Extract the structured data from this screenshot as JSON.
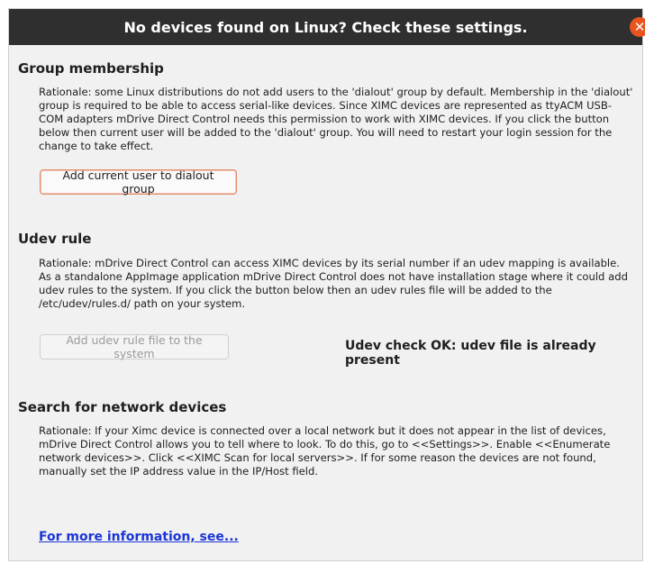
{
  "dialog": {
    "title": "No devices found on Linux? Check these settings.",
    "close_glyph": "✕"
  },
  "group": {
    "title": "Group membership",
    "rationale": "Rationale: some Linux distributions do not add users to the 'dialout' group by default. Membership in the 'dialout' group is required to be able to access serial-like devices. Since XIMC devices are represented as ttyACM USB-COM adapters mDrive Direct Control needs this permission to work with XIMC devices. If you click the button below then current user will be added to the 'dialout' group. You will need to restart your login session for the change to take effect.",
    "button_label": "Add current user to dialout group"
  },
  "udev": {
    "title": "Udev rule",
    "rationale": "Rationale: mDrive Direct Control can access XIMC devices by its serial number if an udev mapping is available. As a standalone AppImage application mDrive Direct Control does not have installation stage where it could add udev rules to the system. If you click the button below then an udev rules file will be added to the /etc/udev/rules.d/ path on your system.",
    "button_label": "Add udev rule file to the system",
    "status": "Udev check OK: udev file is already present"
  },
  "network": {
    "title": "Search for network devices",
    "rationale": "Rationale: If your Ximc device is connected over a local network but it does not appear in the list of devices, mDrive Direct Control allows you to tell where to look. To do this, go to <<Settings>>. Enable <<Enumerate network devices>>. Click <<XIMC Scan for local servers>>. If for some reason the devices are not found, manually set the IP address value in the IP/Host field."
  },
  "footer": {
    "link_label": "For more information, see..."
  },
  "colors": {
    "titlebar": "#2f2f2f",
    "close_button": "#e95420",
    "link": "#1a35d6"
  }
}
